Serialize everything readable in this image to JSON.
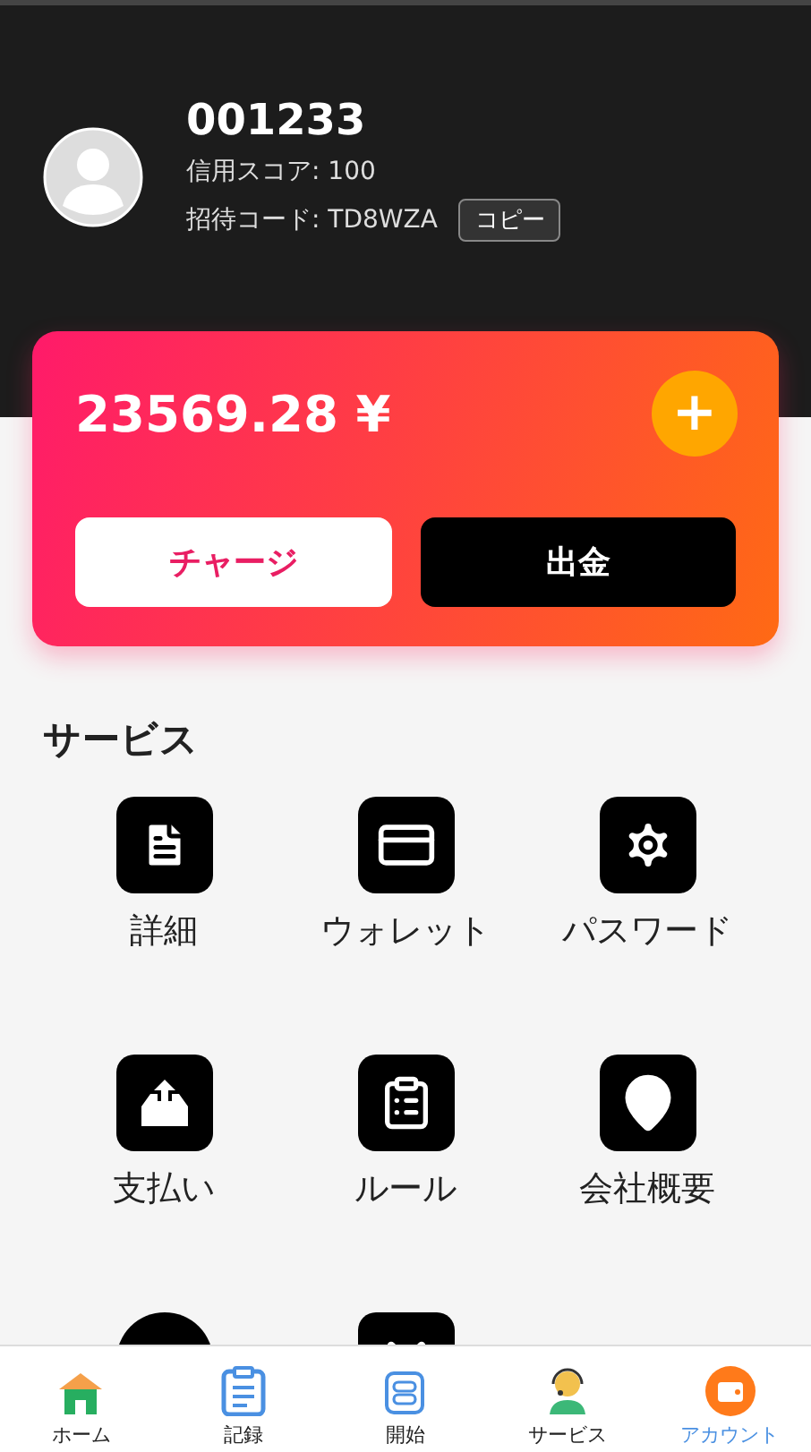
{
  "profile": {
    "user_id": "001233",
    "credit_score": "信用スコア: 100",
    "invite_code": "招待コード: TD8WZA",
    "copy_button": "コピー"
  },
  "balance": {
    "amount": "23569.28 ¥",
    "add_button": "+",
    "charge_button": "チャージ",
    "withdraw_button": "出金"
  },
  "services": {
    "title": "サービス",
    "items": [
      {
        "kind": "labeled",
        "label": "詳細"
      },
      {
        "kind": "labeled",
        "label": "ウォレット"
      },
      {
        "kind": "labeled",
        "label": "パスワード"
      },
      {
        "kind": "labeled",
        "label": "支払い"
      },
      {
        "kind": "labeled",
        "label": "ルール"
      },
      {
        "kind": "labeled",
        "label": "会社概要"
      },
      {
        "kind": "icon-only"
      },
      {
        "kind": "icon-only"
      }
    ]
  },
  "bottom_nav": [
    {
      "label": "ホーム",
      "selected": false
    },
    {
      "label": "記録",
      "selected": false
    },
    {
      "label": "開始",
      "selected": false
    },
    {
      "label": "サービス",
      "selected": false
    },
    {
      "label": "アカウント",
      "selected": true
    }
  ]
}
